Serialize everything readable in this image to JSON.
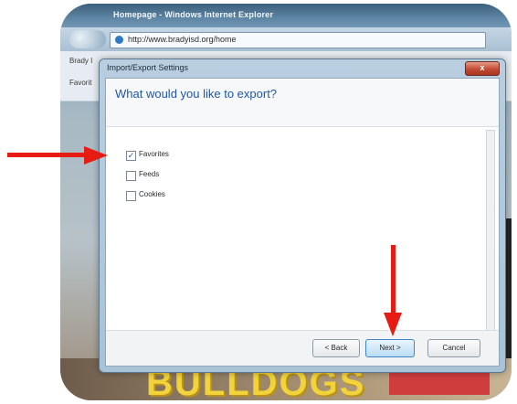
{
  "browser": {
    "window_title": "Homepage - Windows Internet Explorer",
    "address": "http://www.bradyisd.org/home",
    "favorites_bar_label": "Favorit",
    "tab_label": "Brady I"
  },
  "page_background": {
    "banner_text": "BULLDOGS"
  },
  "dialog": {
    "title": "Import/Export Settings",
    "close_glyph": "x",
    "heading": "What would you like to export?",
    "options": [
      {
        "label": "Favorites",
        "checked": true
      },
      {
        "label": "Feeds",
        "checked": false
      },
      {
        "label": "Cookies",
        "checked": false
      }
    ],
    "buttons": {
      "back": "< Back",
      "next": "Next >",
      "cancel": "Cancel"
    }
  },
  "annotations": {
    "arrow_color": "#e51b14"
  },
  "colors": {
    "heading": "#1f57a5",
    "close_button": "#c24b34"
  }
}
